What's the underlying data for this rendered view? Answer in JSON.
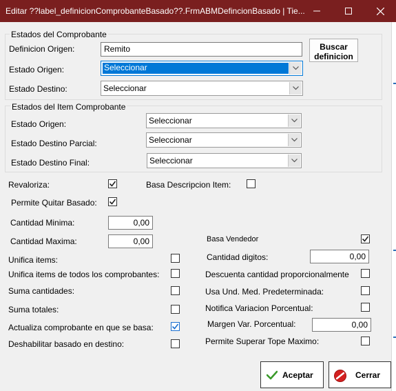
{
  "window": {
    "title": "Editar ??label_definicionComprobanteBasado??.FrmABMDefincionBasado | Tie...",
    "minimize_icon": "minimize-icon",
    "maximize_icon": "maximize-icon",
    "close_icon": "close-icon"
  },
  "estados_comprobante": {
    "legend": "Estados del Comprobante",
    "definicion_origen_label": "Definicion Origen:",
    "definicion_origen_value": "Remito",
    "buscar_label_line1": "Buscar",
    "buscar_label_line2": "definicion",
    "estado_origen_label": "Estado Origen:",
    "estado_origen_value": "Seleccionar",
    "estado_destino_label": "Estado Destino:",
    "estado_destino_value": "Seleccionar"
  },
  "estados_item": {
    "legend": "Estados del Item Comprobante",
    "estado_origen_label": "Estado Origen:",
    "estado_origen_value": "Seleccionar",
    "estado_destino_parcial_label": "Estado Destino Parcial:",
    "estado_destino_parcial_value": "Seleccionar",
    "estado_destino_final_label": "Estado Destino Final:",
    "estado_destino_final_value": "Seleccionar"
  },
  "options": {
    "revaloriza_label": "Revaloriza:",
    "revaloriza_checked": true,
    "basa_descripcion_label": "Basa Descripcion Item:",
    "basa_descripcion_checked": false,
    "permite_quitar_label": "Permite Quitar Basado:",
    "permite_quitar_checked": true,
    "cantidad_minima_label": "Cantidad Minima:",
    "cantidad_minima_value": "0,00",
    "cantidad_maxima_label": "Cantidad Maxima:",
    "cantidad_maxima_value": "0,00",
    "basa_vendedor_label": "Basa Vendedor",
    "basa_vendedor_checked": true,
    "cantidad_digitos_label": "Cantidad digitos:",
    "cantidad_digitos_value": "0,00",
    "unifica_items_label": "Unifica items:",
    "unifica_items_checked": false,
    "unifica_items_todos_label": "Unifica items de todos los comprobantes:",
    "unifica_items_todos_checked": false,
    "descuenta_label": "Descuenta cantidad proporcionalmente",
    "descuenta_checked": false,
    "suma_cantidades_label": "Suma cantidades:",
    "suma_cantidades_checked": false,
    "usa_und_label": "Usa Und. Med. Predeterminada:",
    "usa_und_checked": false,
    "suma_totales_label": "Suma totales:",
    "suma_totales_checked": false,
    "notifica_label": "Notifica Variacion Porcentual:",
    "notifica_checked": false,
    "actualiza_label": "Actualiza comprobante en que se basa:",
    "actualiza_checked": true,
    "margen_label": "Margen Var. Porcentual:",
    "margen_value": "0,00",
    "deshabilitar_label": "Deshabilitar basado en destino:",
    "deshabilitar_checked": false,
    "permite_superar_label": "Permite Superar Tope Maximo:",
    "permite_superar_checked": false
  },
  "buttons": {
    "aceptar_label": "Aceptar",
    "aceptar_icon": "check-icon",
    "cerrar_label": "Cerrar",
    "cerrar_icon": "no-entry-icon"
  },
  "colors": {
    "titlebar": "#7a1f1f",
    "selection": "#0078d7",
    "check_blue": "#1a6fd0",
    "aceptar_green": "#3a9a2a",
    "cerrar_red": "#d42020"
  }
}
